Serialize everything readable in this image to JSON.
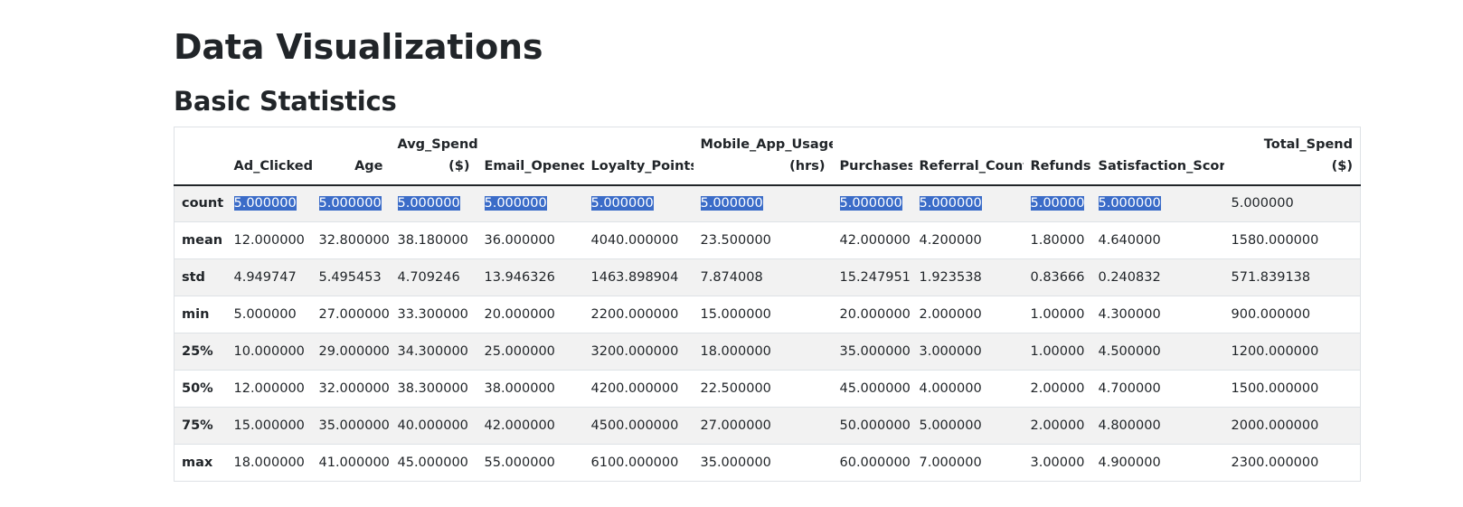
{
  "page_title": "Data Visualizations",
  "section_title": "Basic Statistics",
  "table": {
    "corner": "",
    "columns": [
      {
        "l1": "",
        "l2": "Ad_Clicked",
        "align": "left"
      },
      {
        "l1": "",
        "l2": "Age",
        "align": "right"
      },
      {
        "l1": "Avg_Spend",
        "l2": "($)",
        "align": "right"
      },
      {
        "l1": "",
        "l2": "Email_Opened",
        "align": "left"
      },
      {
        "l1": "",
        "l2": "Loyalty_Points",
        "align": "left"
      },
      {
        "l1": "Mobile_App_Usage",
        "l2": "(hrs)",
        "align": "right"
      },
      {
        "l1": "",
        "l2": "Purchases",
        "align": "left"
      },
      {
        "l1": "",
        "l2": "Referral_Count",
        "align": "left"
      },
      {
        "l1": "",
        "l2": "Refunds",
        "align": "left"
      },
      {
        "l1": "",
        "l2": "Satisfaction_Score",
        "align": "left"
      },
      {
        "l1": "Total_Spend",
        "l2": "($)",
        "align": "right"
      }
    ],
    "rows": [
      {
        "label": "count",
        "values": [
          "5.000000",
          "5.000000",
          "5.000000",
          "5.000000",
          "5.000000",
          "5.000000",
          "5.000000",
          "5.000000",
          "5.00000",
          "5.000000",
          "5.000000"
        ]
      },
      {
        "label": "mean",
        "values": [
          "12.000000",
          "32.800000",
          "38.180000",
          "36.000000",
          "4040.000000",
          "23.500000",
          "42.000000",
          "4.200000",
          "1.80000",
          "4.640000",
          "1580.000000"
        ]
      },
      {
        "label": "std",
        "values": [
          "4.949747",
          "5.495453",
          "4.709246",
          "13.946326",
          "1463.898904",
          "7.874008",
          "15.247951",
          "1.923538",
          "0.83666",
          "0.240832",
          "571.839138"
        ]
      },
      {
        "label": "min",
        "values": [
          "5.000000",
          "27.000000",
          "33.300000",
          "20.000000",
          "2200.000000",
          "15.000000",
          "20.000000",
          "2.000000",
          "1.00000",
          "4.300000",
          "900.000000"
        ]
      },
      {
        "label": "25%",
        "values": [
          "10.000000",
          "29.000000",
          "34.300000",
          "25.000000",
          "3200.000000",
          "18.000000",
          "35.000000",
          "3.000000",
          "1.00000",
          "4.500000",
          "1200.000000"
        ]
      },
      {
        "label": "50%",
        "values": [
          "12.000000",
          "32.000000",
          "38.300000",
          "38.000000",
          "4200.000000",
          "22.500000",
          "45.000000",
          "4.000000",
          "2.00000",
          "4.700000",
          "1500.000000"
        ]
      },
      {
        "label": "75%",
        "values": [
          "15.000000",
          "35.000000",
          "40.000000",
          "42.000000",
          "4500.000000",
          "27.000000",
          "50.000000",
          "5.000000",
          "2.00000",
          "4.800000",
          "2000.000000"
        ]
      },
      {
        "label": "max",
        "values": [
          "18.000000",
          "41.000000",
          "45.000000",
          "55.000000",
          "6100.000000",
          "35.000000",
          "60.000000",
          "7.000000",
          "3.00000",
          "4.900000",
          "2300.000000"
        ]
      }
    ],
    "selected_row": "count",
    "selection_color": "#3b6cc8"
  }
}
